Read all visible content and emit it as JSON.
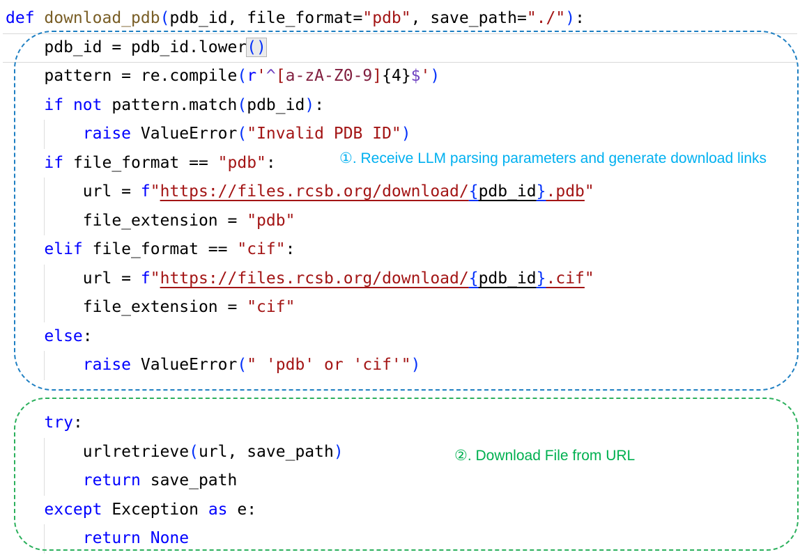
{
  "colors": {
    "keyword": "#0000FF",
    "string": "#A31515",
    "function_name": "#795E26",
    "identifier": "#000000",
    "bracket_pair": "#0431FA",
    "regex_anchor": "#6F42C1",
    "regex_class": "#811F3F",
    "annotation_box_blue": "#1E7FC2",
    "annotation_box_green": "#2BB05C",
    "annotation_text_cyan": "#00B0F0",
    "annotation_text_green": "#00B050"
  },
  "annotations": {
    "step1": {
      "label": "①. Receive LLM parsing parameters and generate download links",
      "color": "#00B0F0"
    },
    "step2": {
      "label": "②. Download File from URL",
      "color": "#00B050"
    }
  },
  "code": {
    "lines": [
      {
        "guide": false,
        "segments": [
          {
            "t": "def ",
            "c": "kw"
          },
          {
            "t": "download_pdb",
            "c": "fn"
          },
          {
            "t": "(",
            "c": "brk"
          },
          {
            "t": "pdb_id, file_format",
            "c": "id"
          },
          {
            "t": "=",
            "c": "id"
          },
          {
            "t": "\"pdb\"",
            "c": "str"
          },
          {
            "t": ", save_path",
            "c": "id"
          },
          {
            "t": "=",
            "c": "id"
          },
          {
            "t": "\"./\"",
            "c": "str"
          },
          {
            "t": ")",
            "c": "brk"
          },
          {
            "t": ":",
            "c": "id"
          }
        ]
      },
      {
        "guide": false,
        "segments": [
          {
            "t": "    pdb_id = pdb_id.lower",
            "c": "id"
          },
          {
            "t": "()",
            "c": "brk",
            "m": true
          }
        ]
      },
      {
        "guide": false,
        "segments": [
          {
            "t": "    pattern = re.compile",
            "c": "id"
          },
          {
            "t": "(",
            "c": "brk"
          },
          {
            "t": "r",
            "c": "kw"
          },
          {
            "t": "'",
            "c": "str"
          },
          {
            "t": "^",
            "c": "rxa"
          },
          {
            "t": "[",
            "c": "str"
          },
          {
            "t": "a-zA-Z0-9",
            "c": "rxc"
          },
          {
            "t": "]",
            "c": "str"
          },
          {
            "t": "{4}",
            "c": "id"
          },
          {
            "t": "$",
            "c": "rxa"
          },
          {
            "t": "'",
            "c": "str"
          },
          {
            "t": ")",
            "c": "brk"
          }
        ]
      },
      {
        "guide": false,
        "segments": [
          {
            "t": "    ",
            "c": "id"
          },
          {
            "t": "if",
            "c": "kw"
          },
          {
            "t": " ",
            "c": "id"
          },
          {
            "t": "not",
            "c": "kw"
          },
          {
            "t": " pattern.match",
            "c": "id"
          },
          {
            "t": "(",
            "c": "brk"
          },
          {
            "t": "pdb_id",
            "c": "id"
          },
          {
            "t": ")",
            "c": "brk"
          },
          {
            "t": ":",
            "c": "id"
          }
        ]
      },
      {
        "guide": true,
        "segments": [
          {
            "t": "        ",
            "c": "id"
          },
          {
            "t": "raise",
            "c": "kw"
          },
          {
            "t": " ValueError",
            "c": "id"
          },
          {
            "t": "(",
            "c": "brk"
          },
          {
            "t": "\"Invalid PDB ID\"",
            "c": "str"
          },
          {
            "t": ")",
            "c": "brk"
          }
        ]
      },
      {
        "guide": false,
        "segments": [
          {
            "t": "    ",
            "c": "id"
          },
          {
            "t": "if",
            "c": "kw"
          },
          {
            "t": " file_format == ",
            "c": "id"
          },
          {
            "t": "\"pdb\"",
            "c": "str"
          },
          {
            "t": ":",
            "c": "id"
          }
        ]
      },
      {
        "guide": true,
        "segments": [
          {
            "t": "        url = ",
            "c": "id"
          },
          {
            "t": "f",
            "c": "kw"
          },
          {
            "t": "\"",
            "c": "str"
          },
          {
            "t": "https://files.rcsb.org/download/",
            "c": "str",
            "u": true
          },
          {
            "t": "{",
            "c": "brk",
            "u": true
          },
          {
            "t": "pdb_id",
            "c": "id",
            "u": true
          },
          {
            "t": "}",
            "c": "brk",
            "u": true
          },
          {
            "t": ".pdb",
            "c": "str",
            "u": true
          },
          {
            "t": "\"",
            "c": "str"
          }
        ]
      },
      {
        "guide": true,
        "segments": [
          {
            "t": "        file_extension = ",
            "c": "id"
          },
          {
            "t": "\"pdb\"",
            "c": "str"
          }
        ]
      },
      {
        "guide": false,
        "segments": [
          {
            "t": "    ",
            "c": "id"
          },
          {
            "t": "elif",
            "c": "kw"
          },
          {
            "t": " file_format == ",
            "c": "id"
          },
          {
            "t": "\"cif\"",
            "c": "str"
          },
          {
            "t": ":",
            "c": "id"
          }
        ]
      },
      {
        "guide": true,
        "segments": [
          {
            "t": "        url = ",
            "c": "id"
          },
          {
            "t": "f",
            "c": "kw"
          },
          {
            "t": "\"",
            "c": "str"
          },
          {
            "t": "https://files.rcsb.org/download/",
            "c": "str",
            "u": true
          },
          {
            "t": "{",
            "c": "brk",
            "u": true
          },
          {
            "t": "pdb_id",
            "c": "id",
            "u": true
          },
          {
            "t": "}",
            "c": "brk",
            "u": true
          },
          {
            "t": ".cif",
            "c": "str",
            "u": true
          },
          {
            "t": "\"",
            "c": "str"
          }
        ]
      },
      {
        "guide": true,
        "segments": [
          {
            "t": "        file_extension = ",
            "c": "id"
          },
          {
            "t": "\"cif\"",
            "c": "str"
          }
        ]
      },
      {
        "guide": false,
        "segments": [
          {
            "t": "    ",
            "c": "id"
          },
          {
            "t": "else",
            "c": "kw"
          },
          {
            "t": ":",
            "c": "id"
          }
        ]
      },
      {
        "guide": true,
        "segments": [
          {
            "t": "        ",
            "c": "id"
          },
          {
            "t": "raise",
            "c": "kw"
          },
          {
            "t": " ValueError",
            "c": "id"
          },
          {
            "t": "(",
            "c": "brk"
          },
          {
            "t": "\" 'pdb' or 'cif'\"",
            "c": "str"
          },
          {
            "t": ")",
            "c": "brk"
          }
        ]
      },
      {
        "guide": false,
        "segments": []
      },
      {
        "guide": false,
        "segments": [
          {
            "t": "    ",
            "c": "id"
          },
          {
            "t": "try",
            "c": "kw"
          },
          {
            "t": ":",
            "c": "id"
          }
        ]
      },
      {
        "guide": true,
        "segments": [
          {
            "t": "        urlretrieve",
            "c": "id"
          },
          {
            "t": "(",
            "c": "brk"
          },
          {
            "t": "url, save_path",
            "c": "id"
          },
          {
            "t": ")",
            "c": "brk"
          }
        ]
      },
      {
        "guide": true,
        "segments": [
          {
            "t": "        ",
            "c": "id"
          },
          {
            "t": "return",
            "c": "kw"
          },
          {
            "t": " save_path",
            "c": "id"
          }
        ]
      },
      {
        "guide": false,
        "segments": [
          {
            "t": "    ",
            "c": "id"
          },
          {
            "t": "except",
            "c": "kw"
          },
          {
            "t": " Exception ",
            "c": "id"
          },
          {
            "t": "as",
            "c": "kw"
          },
          {
            "t": " e:",
            "c": "id"
          }
        ]
      },
      {
        "guide": true,
        "segments": [
          {
            "t": "        ",
            "c": "id"
          },
          {
            "t": "return",
            "c": "kw"
          },
          {
            "t": " ",
            "c": "id"
          },
          {
            "t": "None",
            "c": "kw"
          }
        ]
      }
    ]
  }
}
